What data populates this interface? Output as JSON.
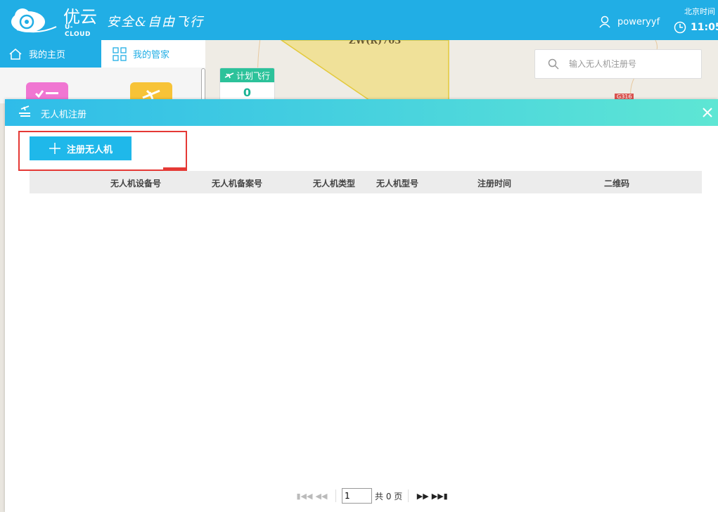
{
  "header": {
    "brand_cn": "优云",
    "brand_en": "U-CLOUD",
    "slogan": "安全&自由飞行",
    "username": "poweryyf",
    "time_label": "北京时间",
    "time_value": "11:05"
  },
  "nav": {
    "home_label": "我的主页",
    "butler_label": "我的管家"
  },
  "map": {
    "zone_label": "ZW(R)703",
    "road_label": "G316",
    "plan_card": {
      "label": "计划飞行",
      "value": "0"
    },
    "search_placeholder": "输入无人机注册号"
  },
  "modal": {
    "title": "无人机注册",
    "register_button": "注册无人机",
    "columns": [
      "无人机设备号",
      "无人机备案号",
      "无人机类型",
      "无人机型号",
      "注册时间",
      "二维码"
    ],
    "pager": {
      "page_value": "1",
      "total_text": "共 0 页"
    }
  },
  "colors": {
    "header_blue": "#21aee5",
    "button_blue": "#1fb8ea",
    "highlight_red": "#e53935",
    "plan_green": "#2cc29a"
  }
}
